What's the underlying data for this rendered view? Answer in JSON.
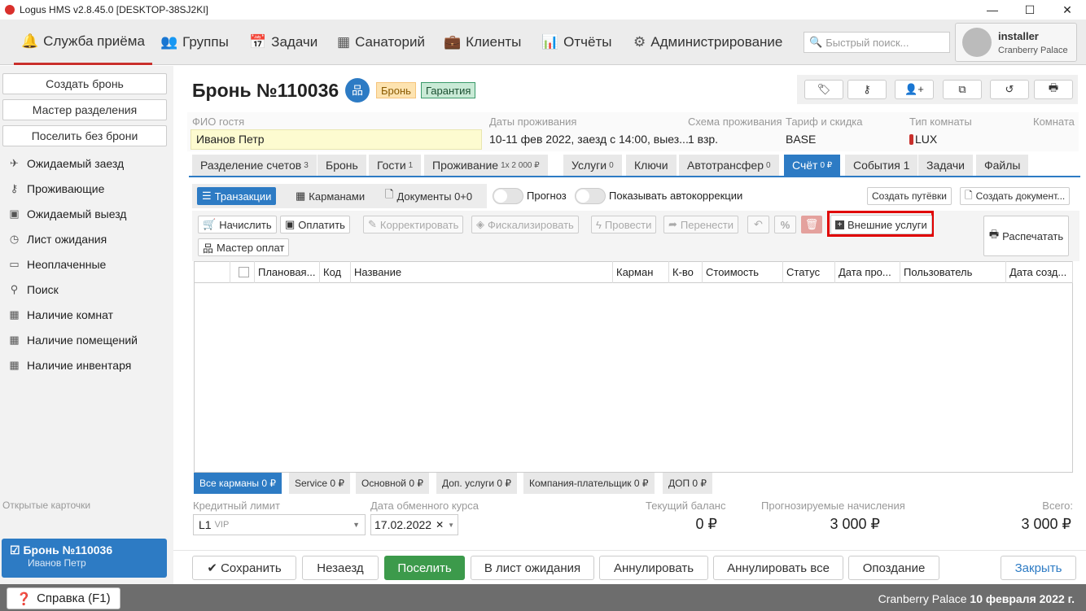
{
  "window": {
    "title": "Logus HMS v2.8.45.0 [DESKTOP-38SJ2KI]"
  },
  "nav": {
    "items": [
      {
        "label": "Служба приёма",
        "icon": "bell-icon"
      },
      {
        "label": "Группы",
        "icon": "users-icon"
      },
      {
        "label": "Задачи",
        "icon": "calendar-check-icon"
      },
      {
        "label": "Санаторий",
        "icon": "building-icon"
      },
      {
        "label": "Клиенты",
        "icon": "briefcase-icon"
      },
      {
        "label": "Отчёты",
        "icon": "bar-chart-icon"
      },
      {
        "label": "Администрирование",
        "icon": "gears-icon"
      }
    ],
    "search_placeholder": "Быстрый поиск...",
    "user": {
      "name": "installer",
      "hotel": "Cranberry Palace"
    }
  },
  "sidebar": {
    "buttons": [
      "Создать бронь",
      "Мастер разделения",
      "Поселить без брони"
    ],
    "items": [
      {
        "label": "Ожидаемый заезд",
        "icon": "plane-icon"
      },
      {
        "label": "Проживающие",
        "icon": "key-icon"
      },
      {
        "label": "Ожидаемый выезд",
        "icon": "suitcase-icon"
      },
      {
        "label": "Лист ожидания",
        "icon": "clock-icon"
      },
      {
        "label": "Неоплаченные",
        "icon": "money-icon"
      },
      {
        "label": "Поиск",
        "icon": "search-icon"
      },
      {
        "label": "Наличие комнат",
        "icon": "grid-icon"
      },
      {
        "label": "Наличие помещений",
        "icon": "grid-icon"
      },
      {
        "label": "Наличие инвентаря",
        "icon": "grid-icon"
      }
    ],
    "open_cards_label": "Открытые карточки",
    "open_card": {
      "title": "Бронь №110036",
      "guest": "Иванов Петр"
    }
  },
  "booking": {
    "title": "Бронь №110036",
    "badges": [
      "Бронь",
      "Гарантия"
    ],
    "fields": {
      "guest_label": "ФИО гостя",
      "guest": "Иванов Петр",
      "dates_label": "Даты проживания",
      "dates": "10-11 фев 2022, заезд с 14:00, выез...",
      "scheme_label": "Схема проживания",
      "scheme": "1 взр.",
      "tariff_label": "Тариф и скидка",
      "tariff": "BASE",
      "roomtype_label": "Тип комнаты",
      "roomtype": "LUX",
      "room_label": "Комната"
    }
  },
  "tabs": [
    {
      "label": "Разделение счетов",
      "sup": "3"
    },
    {
      "label": "Бронь",
      "sup": ""
    },
    {
      "label": "Гости",
      "sup": "1"
    },
    {
      "label": "Проживание",
      "sup": "1x 2 000 ₽"
    },
    {
      "label": "Услуги",
      "sup": "0"
    },
    {
      "label": "Ключи",
      "sup": ""
    },
    {
      "label": "Автотрансфер",
      "sup": "0"
    },
    {
      "label": "Счёт",
      "sup": "0 ₽"
    },
    {
      "label": "События 1",
      "sup": ""
    },
    {
      "label": "Задачи",
      "sup": ""
    },
    {
      "label": "Файлы",
      "sup": ""
    }
  ],
  "account": {
    "views": [
      "Транзакции",
      "Карманами",
      "Документы 0+0"
    ],
    "toggles": [
      "Прогноз",
      "Показывать автокоррекции"
    ],
    "create_voucher": "Создать путёвки",
    "create_doc": "Создать документ...",
    "actions": [
      "Начислить",
      "Оплатить",
      "Корректировать",
      "Фискализировать",
      "Провести",
      "Перенести",
      "Внешние услуги",
      "Мастер оплат",
      "Распечатать"
    ],
    "columns": [
      "Плановая...",
      "Код",
      "Название",
      "Карман",
      "К-во",
      "Стоимость",
      "Статус",
      "Дата про...",
      "Пользователь",
      "Дата созд..."
    ],
    "pockets": [
      "Все карманы 0 ₽",
      "Service 0 ₽",
      "Основной 0 ₽",
      "Доп. услуги 0 ₽",
      "Компания-плательщик 0 ₽",
      "ДОП 0 ₽"
    ],
    "credit_label": "Кредитный лимит",
    "credit_value": "L1",
    "credit_sub": "VIP",
    "rate_label": "Дата обменного курса",
    "rate_value": "17.02.2022",
    "balance_label": "Текущий баланс",
    "balance": "0 ₽",
    "forecast_label": "Прогнозируемые начисления",
    "forecast": "3 000 ₽",
    "total_label": "Всего:",
    "total": "3 000 ₽"
  },
  "bottom": [
    "Сохранить",
    "Незаезд",
    "Поселить",
    "В лист ожидания",
    "Аннулировать",
    "Аннулировать все",
    "Опоздание",
    "Закрыть"
  ],
  "footer": {
    "help": "Справка (F1)",
    "hotel": "Cranberry Palace",
    "date": "10 февраля 2022 г."
  },
  "colors": {
    "accent": "#2d7bc4",
    "highlight": "#e00000",
    "success": "#3c9a4b"
  }
}
